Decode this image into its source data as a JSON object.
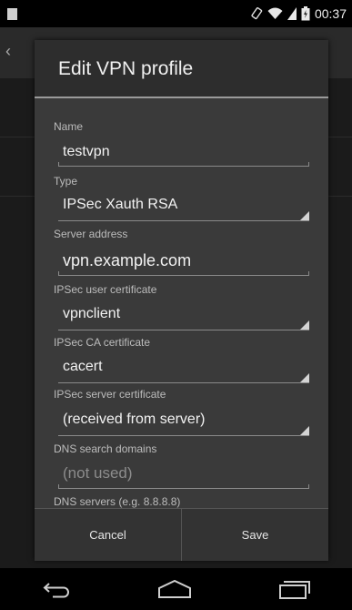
{
  "status_bar": {
    "time": "00:37"
  },
  "dialog": {
    "title": "Edit VPN profile",
    "fields": {
      "name_label": "Name",
      "name_value": "testvpn",
      "type_label": "Type",
      "type_value": "IPSec Xauth RSA",
      "server_label": "Server address",
      "server_value": "vpn.example.com",
      "user_cert_label": "IPSec user certificate",
      "user_cert_value": "vpnclient",
      "ca_cert_label": "IPSec CA certificate",
      "ca_cert_value": "cacert",
      "server_cert_label": "IPSec server certificate",
      "server_cert_value": "(received from server)",
      "dns_domains_label": "DNS search domains",
      "dns_domains_placeholder": "(not used)",
      "dns_servers_label": "DNS servers (e.g. 8.8.8.8)"
    },
    "buttons": {
      "cancel": "Cancel",
      "save": "Save"
    }
  },
  "icons": {
    "status": [
      "notification-icon",
      "rotate-icon",
      "wifi-icon",
      "signal-icon",
      "battery-icon"
    ],
    "nav": [
      "back-icon",
      "home-icon",
      "recents-icon"
    ]
  }
}
